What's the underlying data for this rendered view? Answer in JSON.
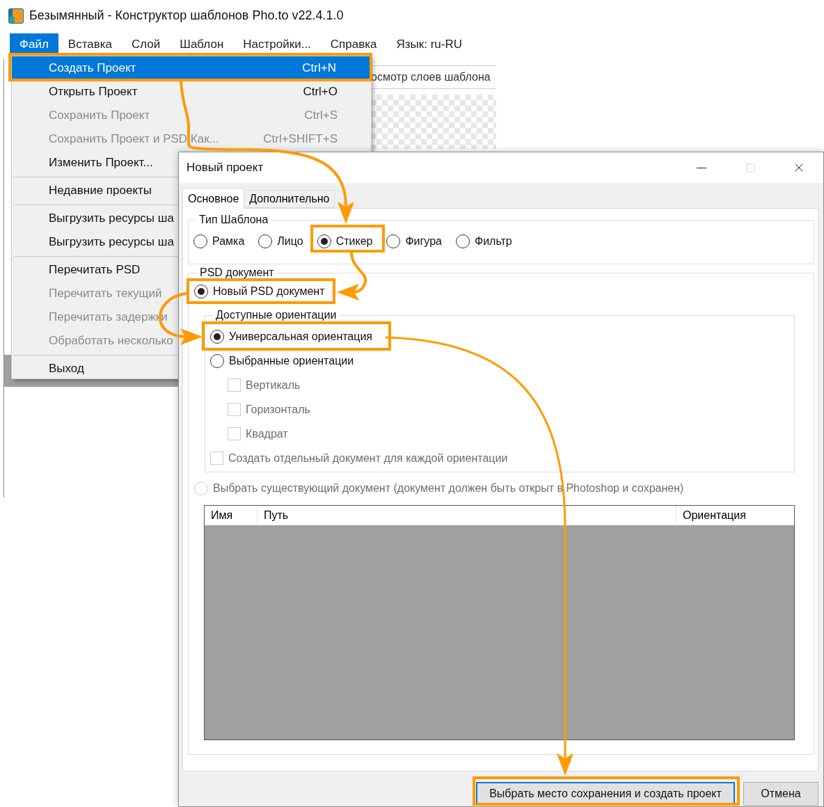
{
  "app_window": {
    "title": "Безымянный - Конструктор шаблонов Pho.to v22.4.1.0"
  },
  "menu_bar": [
    {
      "label": "Файл",
      "selected": true
    },
    {
      "label": "Вставка",
      "selected": false
    },
    {
      "label": "Слой",
      "selected": false
    },
    {
      "label": "Шаблон",
      "selected": false
    },
    {
      "label": "Настройки...",
      "selected": false
    },
    {
      "label": "Справка",
      "selected": false
    },
    {
      "label": "Язык: ru-RU",
      "selected": false
    }
  ],
  "toolbar": {
    "layers_preview": "осмотр слоев шаблона"
  },
  "file_menu": [
    {
      "items": [
        {
          "label": "Создать Проект",
          "shortcut": "Ctrl+N",
          "disabled": false,
          "selected": true
        },
        {
          "label": "Открыть Проект",
          "shortcut": "Ctrl+O",
          "disabled": false,
          "selected": false
        },
        {
          "label": "Сохранить Проект",
          "shortcut": "Ctrl+S",
          "disabled": true,
          "selected": false
        },
        {
          "label": "Сохранить Проект и PSD Как...",
          "shortcut": "Ctrl+SHIFT+S",
          "disabled": true,
          "selected": false
        },
        {
          "label": "Изменить Проект...",
          "disabled": false,
          "selected": false
        }
      ]
    },
    {
      "items": [
        {
          "label": "Недавние проекты",
          "disabled": false,
          "selected": false
        }
      ]
    },
    {
      "items": [
        {
          "label": "Выгрузить ресурсы ша",
          "disabled": false,
          "selected": false
        },
        {
          "label": "Выгрузить ресурсы ша",
          "disabled": false,
          "selected": false
        }
      ]
    },
    {
      "items": [
        {
          "label": "Перечитать PSD",
          "disabled": false,
          "selected": false
        },
        {
          "label": "Перечитать текущий",
          "disabled": true,
          "selected": false
        },
        {
          "label": "Перечитать задержки",
          "disabled": true,
          "selected": false
        },
        {
          "label": "Обработать несколько",
          "disabled": true,
          "selected": false
        }
      ]
    },
    {
      "items": [
        {
          "label": "Выход",
          "disabled": false,
          "selected": false
        }
      ]
    }
  ],
  "dialog": {
    "title": "Новый проект",
    "tabs": [
      {
        "label": "Основное",
        "selected": true
      },
      {
        "label": "Дополнительно",
        "selected": false
      }
    ],
    "template_type": {
      "label": "Тип Шаблона",
      "options": [
        {
          "label": "Рамка",
          "selected": false
        },
        {
          "label": "Лицо",
          "selected": false
        },
        {
          "label": "Стикер",
          "selected": true
        },
        {
          "label": "Фигура",
          "selected": false
        },
        {
          "label": "Фильтр",
          "selected": false
        }
      ]
    },
    "psd_document": {
      "label": "PSD документ",
      "new_document": {
        "label": "Новый PSD документ",
        "selected": true
      },
      "orientations": {
        "label": "Доступные ориентации",
        "options": [
          {
            "label": "Универсальная ориентация",
            "selected": true
          },
          {
            "label": "Выбранные ориентации",
            "selected": false
          }
        ],
        "choices": [
          {
            "label": "Вертикаль",
            "checked": false,
            "disabled": true
          },
          {
            "label": "Горизонталь",
            "checked": false,
            "disabled": true
          },
          {
            "label": "Квадрат",
            "checked": false,
            "disabled": true
          }
        ],
        "separate_documents": {
          "label": "Создать отдельный документ для каждой ориентации",
          "checked": false,
          "disabled": true
        }
      },
      "existing_document": {
        "label": "Выбрать существующий документ (документ должен быть открыт в Photoshop и сохранен)",
        "selected": false,
        "disabled": true
      },
      "table": {
        "columns": [
          "Имя",
          "Путь",
          "Ориентация"
        ]
      }
    },
    "buttons": [
      {
        "label": "Выбрать место сохранения и создать проект",
        "default": true
      },
      {
        "label": "Отмена",
        "default": false
      }
    ]
  }
}
